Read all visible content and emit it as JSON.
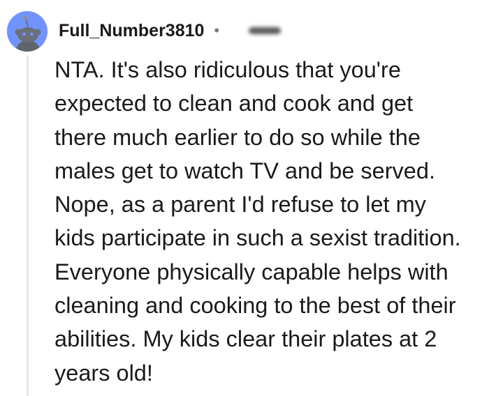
{
  "comment": {
    "username": "Full_Number3810",
    "separator": "•",
    "timestamp_blurred": true,
    "avatar_icon": "reddit-snoo-avatar-icon",
    "avatar_color": "#7193ff",
    "body": "NTA. It's also ridiculous that you're\nexpected to clean and cook and get\nthere much earlier to do so while the\nmales get to watch TV and be served.\nNope, as a parent I'd refuse to let my\nkids participate in such a sexist tradition.\nEveryone physically capable helps with\ncleaning and cooking to the best of their\nabilities. My kids clear their plates at 2\nyears old!"
  }
}
